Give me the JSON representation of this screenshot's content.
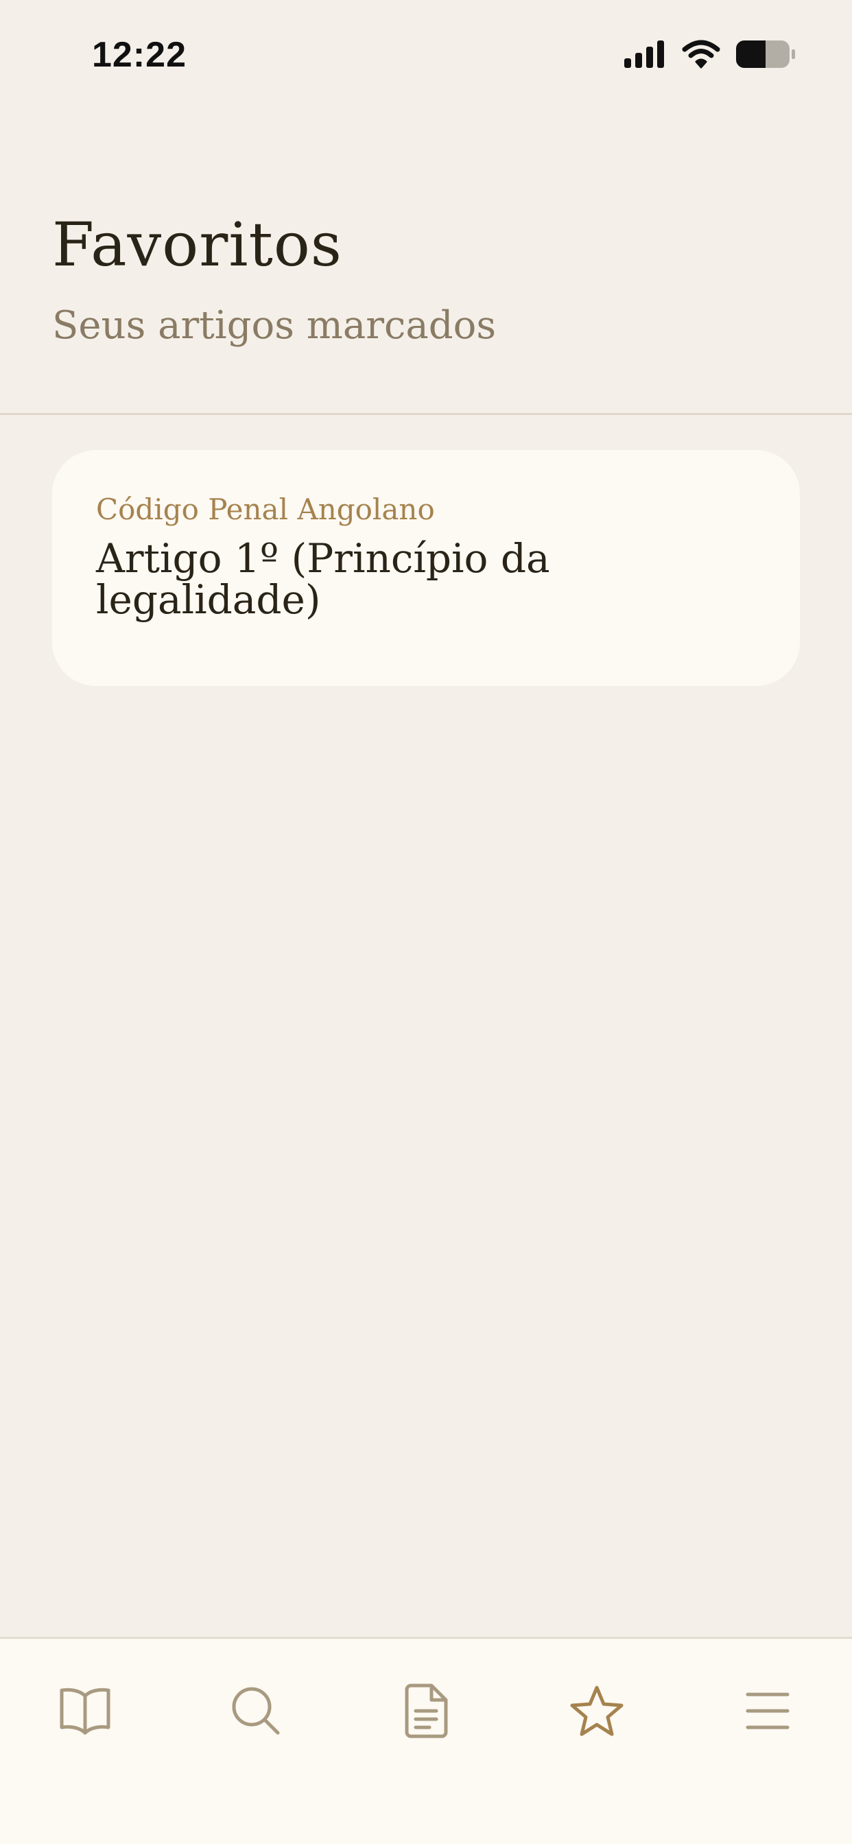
{
  "status_bar": {
    "time": "12:22",
    "icons": [
      "signal-icon",
      "wifi-icon",
      "battery-icon"
    ]
  },
  "header": {
    "title": "Favoritos",
    "subtitle": "Seus artigos marcados"
  },
  "favorites": [
    {
      "source": "Código Penal Angolano",
      "title": "Artigo 1º (Princípio da legalidade)"
    }
  ],
  "tab_bar": {
    "active": "favorites",
    "items": [
      {
        "id": "library",
        "icon": "book-open-icon"
      },
      {
        "id": "search",
        "icon": "search-icon"
      },
      {
        "id": "documents",
        "icon": "document-icon"
      },
      {
        "id": "favorites",
        "icon": "star-icon"
      },
      {
        "id": "menu",
        "icon": "menu-icon"
      }
    ]
  },
  "colors": {
    "background": "#f4f0e9",
    "card": "#fdf9f3",
    "accent": "#a5834e",
    "icon_inactive": "#a89a80",
    "title": "#2a2418",
    "subtitle": "#8a7b64"
  }
}
